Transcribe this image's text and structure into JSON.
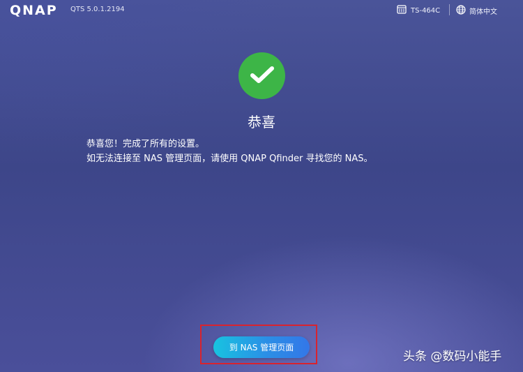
{
  "header": {
    "logo": "QNAP",
    "version": "QTS 5.0.1.2194",
    "model": "TS-464C",
    "model_icon": "nas-device-icon",
    "language": "简体中文",
    "language_icon": "globe-icon"
  },
  "main": {
    "status_icon": "checkmark-icon",
    "status_color": "#3db547",
    "title": "恭喜",
    "message_line1": "恭喜您！完成了所有的设置。",
    "message_line2": "如无法连接至 NAS 管理页面，请使用 QNAP Qfinder 寻找您的 NAS。"
  },
  "footer": {
    "button_label": "到 NAS 管理页面",
    "highlight_color": "#d9232e"
  },
  "watermark": "头条 @数码小能手"
}
